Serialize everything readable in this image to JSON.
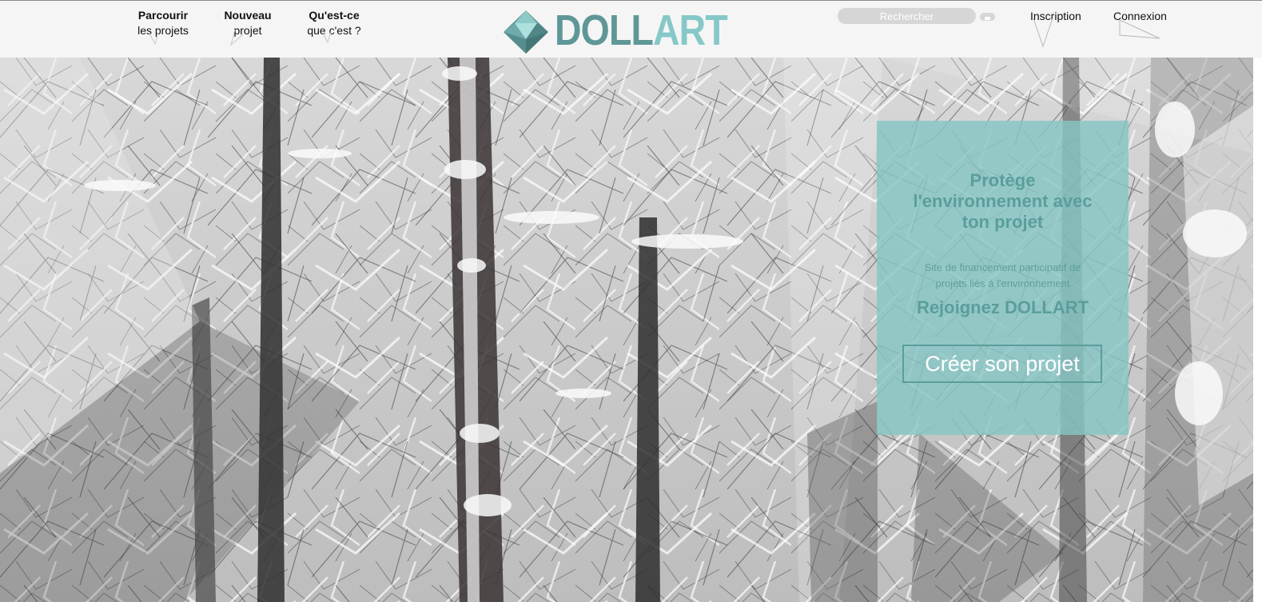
{
  "nav": [
    {
      "line1": "Parcourir",
      "line2": "les projets"
    },
    {
      "line1": "Nouveau",
      "line2": "projet"
    },
    {
      "line1": "Qu'est-ce",
      "line2": "que c'est ?"
    }
  ],
  "logo": {
    "part1": "DOLL",
    "part2": "ART"
  },
  "search": {
    "placeholder": "Rechercher"
  },
  "auth": {
    "signup": "Inscription",
    "login": "Connexion"
  },
  "hero": {
    "title_lines": [
      "Protège",
      "l'environnement avec",
      "ton projet"
    ],
    "description_lines": [
      "Site de financement participatif de",
      "projets liés à l'environnement"
    ],
    "join": "Rejoignez DOLLART",
    "button": "Créer son projet"
  },
  "colors": {
    "brand_dark": "#5f9797",
    "brand_light": "#86c8c8",
    "panel": "#86c6c4",
    "header_bg": "#f5f5f5"
  }
}
